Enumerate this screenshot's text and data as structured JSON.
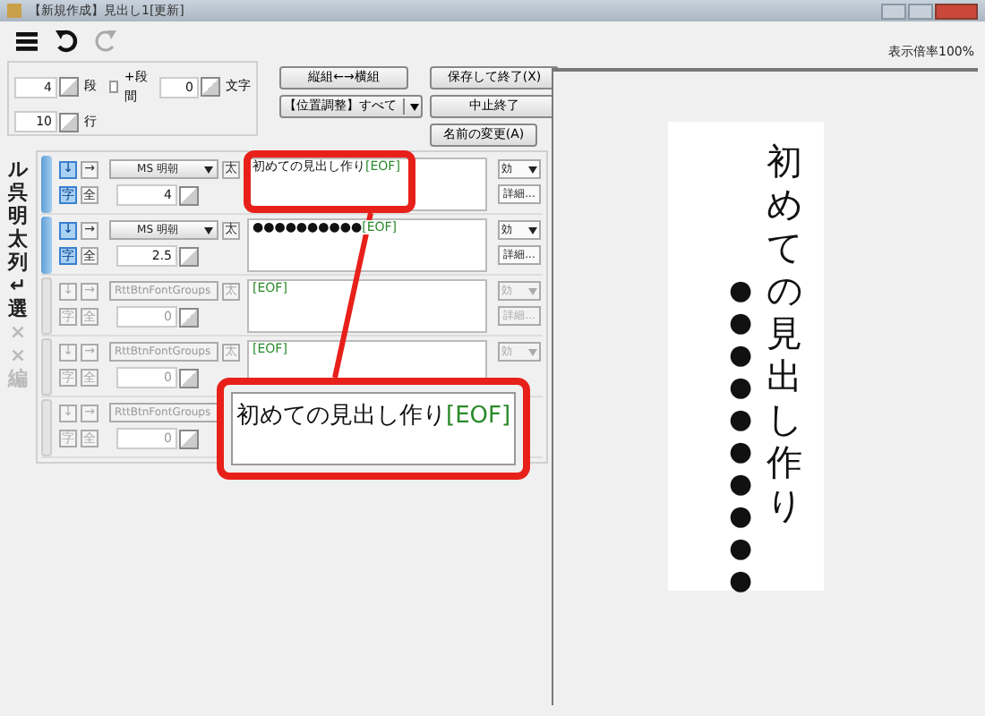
{
  "window": {
    "title": "【新規作成】見出し1[更新]"
  },
  "toolbar": [
    {
      "kind": "menu",
      "disabled": false
    },
    {
      "kind": "undo",
      "disabled": false
    },
    {
      "kind": "redo",
      "disabled": true
    }
  ],
  "layout": {
    "columns": "4",
    "columns_unit": "段",
    "gap": {
      "label": "+段間",
      "checked": false
    },
    "chars": "0",
    "chars_unit": "文字",
    "lines": "10",
    "lines_unit": "行"
  },
  "buttons": [
    {
      "label": "縦組←→横組",
      "kind": "plain"
    },
    {
      "label": "保存して終了(X)",
      "kind": "plain"
    },
    {
      "label": "【位置調整】すべて",
      "kind": "dropdown"
    },
    {
      "label": "中止終了",
      "kind": "plain"
    },
    {
      "label": "名前の変更(A)",
      "kind": "small"
    }
  ],
  "side_tools": [
    {
      "label": "ル",
      "disabled": false
    },
    {
      "label": "呉",
      "disabled": false
    },
    {
      "label": "明",
      "disabled": false
    },
    {
      "label": "太",
      "disabled": false
    },
    {
      "label": "列",
      "disabled": false
    },
    {
      "label": "↵",
      "disabled": false
    },
    {
      "label": "選",
      "disabled": false
    },
    {
      "label": "×",
      "disabled": true
    },
    {
      "label": "×",
      "disabled": true
    },
    {
      "label": "編",
      "disabled": true
    }
  ],
  "rows": [
    {
      "disabled": false,
      "directions": [
        {
          "label": "↓",
          "selected": true
        },
        {
          "label": "→",
          "selected": false
        }
      ],
      "font": "MS 明朝",
      "bold": "太",
      "widths": [
        {
          "label": "字",
          "selected": true
        },
        {
          "label": "全",
          "selected": false
        }
      ],
      "size": "4",
      "text": "初めての見出し作り",
      "eof": "[EOF]",
      "effect": "効",
      "detail": "詳細..."
    },
    {
      "disabled": false,
      "directions": [
        {
          "label": "↓",
          "selected": true
        },
        {
          "label": "→",
          "selected": false
        }
      ],
      "font": "MS 明朝",
      "bold": "太",
      "widths": [
        {
          "label": "字",
          "selected": true
        },
        {
          "label": "全",
          "selected": false
        }
      ],
      "size": "2.5",
      "text": "●●●●●●●●●●",
      "eof": "[EOF]",
      "effect": "効",
      "detail": "詳細..."
    },
    {
      "disabled": true,
      "directions": [
        {
          "label": "↓",
          "selected": false
        },
        {
          "label": "→",
          "selected": false
        }
      ],
      "font": "RttBtnFontGroups",
      "bold": "太",
      "widths": [
        {
          "label": "字",
          "selected": false
        },
        {
          "label": "全",
          "selected": false
        }
      ],
      "size": "0",
      "eof": "[EOF]",
      "effect": "効",
      "detail": "詳細..."
    },
    {
      "disabled": true,
      "directions": [
        {
          "label": "↓",
          "selected": false
        },
        {
          "label": "→",
          "selected": false
        }
      ],
      "font": "RttBtnFontGroups",
      "bold": "太",
      "widths": [
        {
          "label": "字",
          "selected": false
        },
        {
          "label": "全",
          "selected": false
        }
      ],
      "size": "0",
      "eof": "[EOF]",
      "effect": "効"
    },
    {
      "disabled": true,
      "directions": [
        {
          "label": "↓",
          "selected": false
        },
        {
          "label": "→",
          "selected": false
        }
      ],
      "font": "RttBtnFontGroups",
      "widths": [
        {
          "label": "字",
          "selected": false
        },
        {
          "label": "全",
          "selected": false
        }
      ],
      "size": "0"
    }
  ],
  "callout": {
    "text": "初めての見出し作り",
    "eof": "[EOF]"
  },
  "zoom_label": "表示倍率100%",
  "preview": {
    "columns": [
      "初めての見出し作り",
      "●●●●●●●●●●"
    ]
  }
}
